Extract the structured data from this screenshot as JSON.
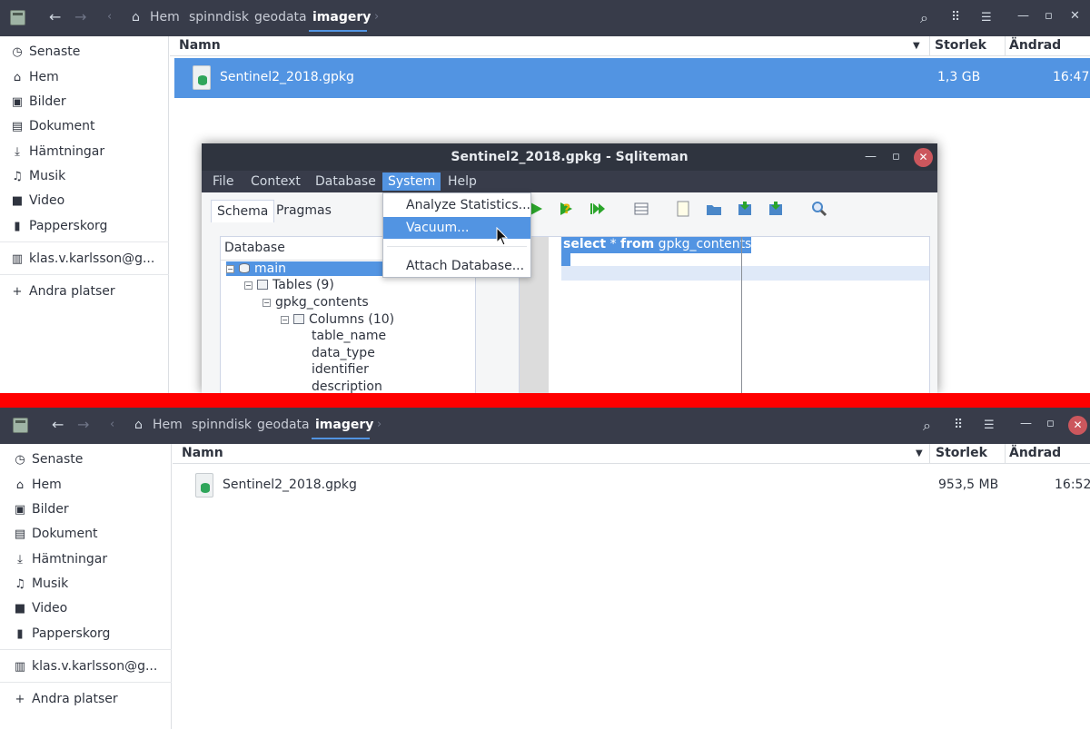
{
  "top_window": {
    "breadcrumbs": [
      "Hem",
      "spinndisk",
      "geodata",
      "imagery"
    ],
    "sidebar": [
      "Senaste",
      "Hem",
      "Bilder",
      "Dokument",
      "Hämtningar",
      "Musik",
      "Video",
      "Papperskorg",
      "klas.v.karlsson@g...",
      "Andra platser"
    ],
    "columns": {
      "name": "Namn",
      "size": "Storlek",
      "modified": "Ändrad"
    },
    "file": {
      "name": "Sentinel2_2018.gpkg",
      "size": "1,3 GB",
      "modified": "16:47",
      "selected": true
    }
  },
  "sqliteman": {
    "title": "Sentinel2_2018.gpkg - Sqliteman",
    "menus": [
      "File",
      "Context",
      "Database",
      "System",
      "Help"
    ],
    "active_menu": "System",
    "system_menu": [
      "Analyze Statistics...",
      "Vacuum...",
      "Attach Database..."
    ],
    "highlighted_item": "Vacuum...",
    "tabs": [
      "Schema",
      "Pragmas"
    ],
    "tree": {
      "header": "Database",
      "nodes": [
        "main",
        "Tables (9)",
        "gpkg_contents",
        "Columns (10)",
        "table_name",
        "data_type",
        "identifier",
        "description"
      ]
    },
    "sql": {
      "kw1": "select",
      "star": " * ",
      "kw2": "from",
      "table": " gpkg_contents"
    }
  },
  "bottom_window": {
    "breadcrumbs": [
      "Hem",
      "spinndisk",
      "geodata",
      "imagery"
    ],
    "sidebar": [
      "Senaste",
      "Hem",
      "Bilder",
      "Dokument",
      "Hämtningar",
      "Musik",
      "Video",
      "Papperskorg",
      "klas.v.karlsson@g...",
      "Andra platser"
    ],
    "columns": {
      "name": "Namn",
      "size": "Storlek",
      "modified": "Ändrad"
    },
    "file": {
      "name": "Sentinel2_2018.gpkg",
      "size": "953,5 MB",
      "modified": "16:52",
      "selected": false
    }
  },
  "colors": {
    "accent": "#5294e2",
    "headerbar": "#383c4a",
    "divider": "#ff0000",
    "close": "#cc575d"
  }
}
